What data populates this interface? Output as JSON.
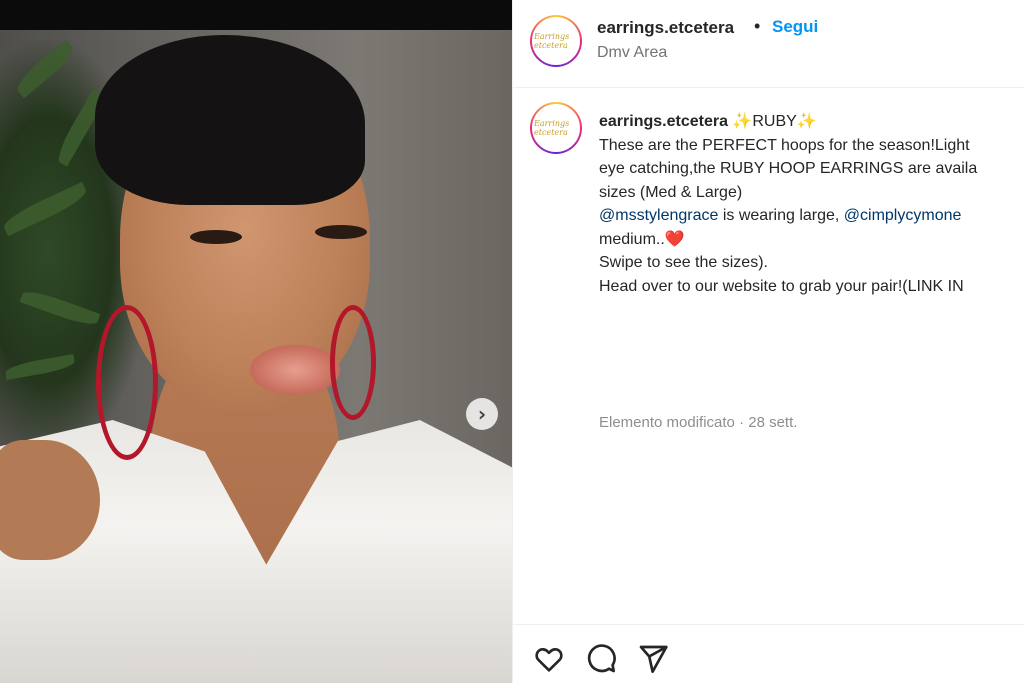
{
  "post": {
    "username": "earrings.etcetera",
    "separator": "•",
    "follow_label": "Segui",
    "location": "Dmv Area",
    "avatar_text": "Earrings etcetera",
    "next_icon": "chevron-right-icon",
    "caption": {
      "username": "earrings.etcetera",
      "lines": [
        " ✨RUBY✨",
        "These are the PERFECT hoops for the season!Light",
        "eye catching,the RUBY HOOP EARRINGS are availa",
        "sizes (Med & Large)"
      ],
      "mention_1": "@msstylengrace",
      "mention_text": " is wearing large, ",
      "mention_2": "@cimplycymone",
      "line_medium": "medium..",
      "heart": "❤️",
      "line_swipe": "Swipe to see the sizes).",
      "line_website": "Head over to our website to grab your pair!(LINK IN"
    },
    "meta": "Elemento modificato · 28 sett."
  },
  "actions": {
    "like_icon": "heart-outline-icon",
    "comment_icon": "comment-icon",
    "share_icon": "send-icon"
  },
  "colors": {
    "accent": "#0095f6",
    "mention": "#00376b",
    "muted": "#737373"
  }
}
